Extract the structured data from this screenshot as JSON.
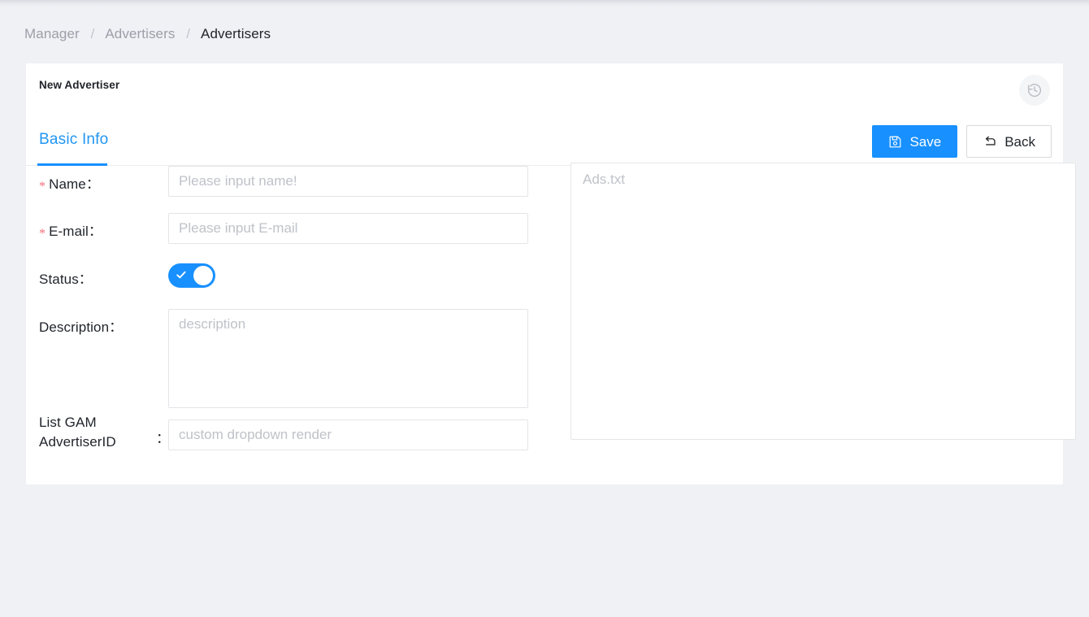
{
  "breadcrumb": {
    "separator": "/",
    "items": [
      {
        "label": "Manager",
        "current": false
      },
      {
        "label": "Advertisers",
        "current": false
      },
      {
        "label": "Advertisers",
        "current": true
      }
    ]
  },
  "card": {
    "title": "New Advertiser",
    "history_icon": "history-clock-icon"
  },
  "tabs": [
    {
      "label": "Basic Info",
      "active": true
    }
  ],
  "actions": {
    "save_label": "Save",
    "save_icon": "save-floppy-icon",
    "back_label": "Back",
    "back_icon": "rollback-arrow-icon"
  },
  "form": {
    "required_marker": "*",
    "colon": "：",
    "fields": {
      "name": {
        "label": "Name",
        "required": true,
        "placeholder": "Please input name!",
        "value": ""
      },
      "email": {
        "label": "E-mail",
        "required": true,
        "placeholder": "Please input E-mail",
        "value": ""
      },
      "status": {
        "label": "Status",
        "required": false,
        "checked": true
      },
      "description": {
        "label": "Description",
        "required": false,
        "placeholder": "description",
        "value": ""
      },
      "gam_advertiser_id": {
        "label": "List GAM AdvertiserID",
        "required": false,
        "placeholder": "custom dropdown render",
        "value": ""
      }
    }
  },
  "ads_txt": {
    "placeholder": "Ads.txt",
    "value": ""
  },
  "colors": {
    "page_background": "#f0f1f5",
    "card_background": "#ffffff",
    "accent": "#1890ff",
    "tab_active": "#2196f3",
    "required_asterisk": "#f5707a",
    "text_primary": "#1f2329",
    "text_muted": "#9b9fa8",
    "placeholder": "#bfc2c9",
    "border": "#e4e5e8"
  }
}
